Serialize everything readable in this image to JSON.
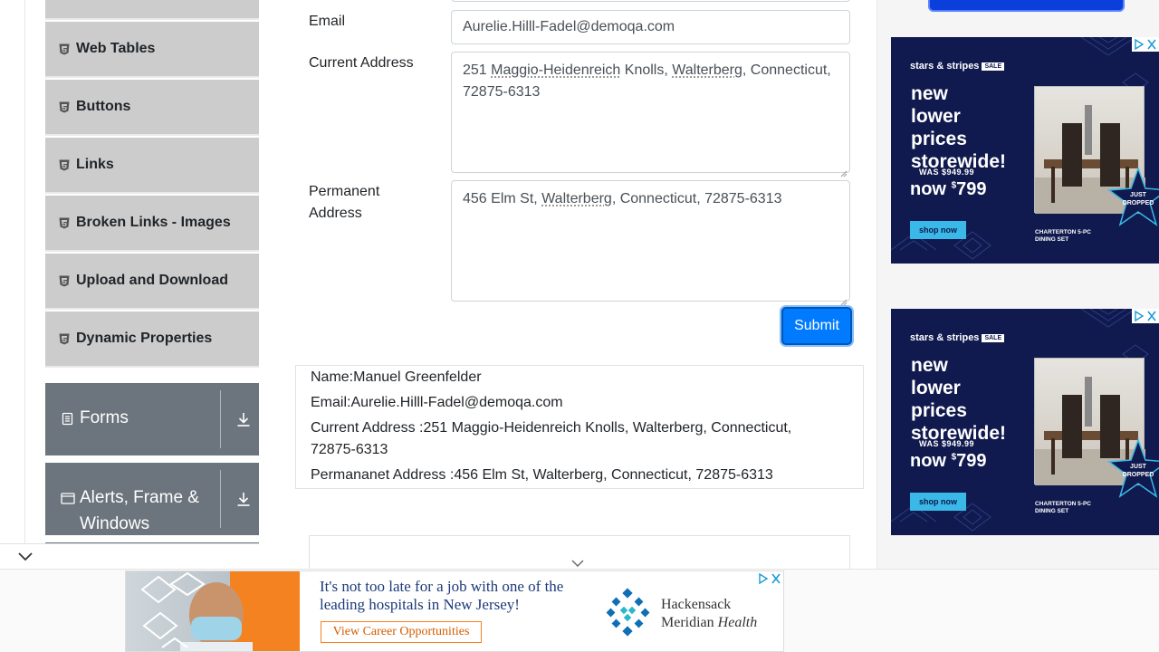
{
  "sidebar": {
    "items": [
      {
        "label": "Web Tables"
      },
      {
        "label": "Buttons"
      },
      {
        "label": "Links"
      },
      {
        "label": "Broken Links - Images"
      },
      {
        "label": "Upload and Download"
      },
      {
        "label": "Dynamic Properties"
      }
    ],
    "groups": [
      {
        "label": "Forms",
        "icon": "document-icon"
      },
      {
        "label": "Alerts, Frame & Windows",
        "icon": "window-icon"
      }
    ]
  },
  "form": {
    "email_label": "Email",
    "email_value": "Aurelie.Hilll-Fadel@demoqa.com",
    "current_address_label": "Current Address",
    "current_address": {
      "p1": "251 ",
      "w1": "Maggio-Heidenreich",
      "p2": " Knolls, ",
      "w2": "Walterberg",
      "p3": ", Connecticut, 72875-6313"
    },
    "permanent_address_label_1": "Permanent",
    "permanent_address_label_2": "Address",
    "permanent_address": {
      "p1": "456 Elm St, ",
      "w1": "Walterberg",
      "p2": ", Connecticut, 72875-6313"
    },
    "submit_label": "Submit"
  },
  "output": {
    "name": "Name:Manuel Greenfelder",
    "email": "Email:Aurelie.Hilll-Fadel@demoqa.com",
    "current_address_1": "Current Address :251 Maggio-Heidenreich Knolls, Walterberg, Connecticut,",
    "current_address_2": "72875-6313",
    "permanent_address": "Permananet Address :456 Elm St, Walterberg, Connecticut, 72875-6313"
  },
  "ads": {
    "side": {
      "brand": "stars & stripes",
      "sale": "SALE",
      "headline_1": "new",
      "headline_2": "lower prices",
      "headline_3": "storewide!",
      "was": "WAS $949.99",
      "now_currency": "$",
      "now_price": "799",
      "now_word": "now",
      "shop": "shop now",
      "product_1": "CHARTERTON 5-PC",
      "product_2": "DINING SET",
      "just_1": "JUST",
      "just_2": "DROPPED"
    },
    "banner": {
      "line1": "It's not too late for a job with one of the",
      "line2": "leading hospitals in New Jersey!",
      "cta": "View Career Opportunities",
      "logo_1": "Hackensack",
      "logo_2a": "Meridian ",
      "logo_2b": "Health"
    }
  },
  "colors": {
    "sidebar_item_bg": "#cccccc",
    "group_bg": "#6c757d",
    "submit_bg": "#007bff",
    "ad_navy": "#101a4e",
    "ad_cta_orange": "#f58220"
  }
}
